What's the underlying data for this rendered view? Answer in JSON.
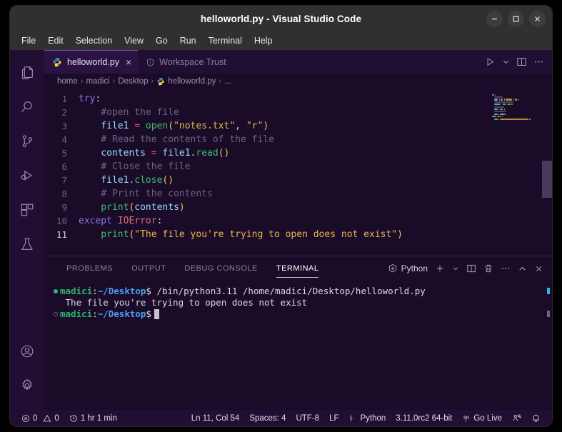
{
  "window": {
    "title": "helloworld.py - Visual Studio Code",
    "controls": [
      {
        "name": "minimize-button",
        "glyph": "minimize"
      },
      {
        "name": "maximize-button",
        "glyph": "maximize"
      },
      {
        "name": "close-button",
        "glyph": "close"
      }
    ]
  },
  "menubar": {
    "items": [
      "File",
      "Edit",
      "Selection",
      "View",
      "Go",
      "Run",
      "Terminal",
      "Help"
    ]
  },
  "activitybar": {
    "top_items": [
      {
        "name": "explorer",
        "label": "Explorer"
      },
      {
        "name": "search",
        "label": "Search"
      },
      {
        "name": "source-control",
        "label": "Source Control"
      },
      {
        "name": "run-and-debug",
        "label": "Run and Debug"
      },
      {
        "name": "extensions",
        "label": "Extensions"
      },
      {
        "name": "testing",
        "label": "Testing"
      }
    ],
    "bottom_items": [
      {
        "name": "accounts",
        "label": "Accounts"
      },
      {
        "name": "manage",
        "label": "Manage"
      }
    ]
  },
  "tabs": {
    "active": {
      "label": "helloworld.py",
      "close": "×"
    },
    "inactive": {
      "label": "Workspace Trust"
    },
    "actions": [
      "run-python-file",
      "run-chevron",
      "split-editor",
      "more-actions"
    ]
  },
  "breadcrumbs": {
    "segments": [
      "home",
      "madici",
      "Desktop",
      "helloworld.py",
      "..."
    ],
    "separator": "›"
  },
  "editor": {
    "lines": [
      {
        "num": "1",
        "tokens": [
          {
            "t": "kw",
            "v": "try"
          },
          {
            "t": "punct",
            "v": ":"
          }
        ]
      },
      {
        "num": "2",
        "tokens": [
          {
            "t": "cmt",
            "v": "    #open the file"
          }
        ]
      },
      {
        "num": "3",
        "tokens": [
          {
            "t": "var",
            "v": "    file1 "
          },
          {
            "t": "op",
            "v": "="
          },
          {
            "t": "fn",
            "v": " open"
          },
          {
            "t": "paren",
            "v": "("
          },
          {
            "t": "str",
            "v": "\"notes.txt\""
          },
          {
            "t": "punct",
            "v": ", "
          },
          {
            "t": "str",
            "v": "\"r\""
          },
          {
            "t": "paren",
            "v": ")"
          }
        ]
      },
      {
        "num": "4",
        "tokens": [
          {
            "t": "cmt",
            "v": "    # Read the contents of the file"
          }
        ]
      },
      {
        "num": "5",
        "tokens": [
          {
            "t": "var",
            "v": "    contents "
          },
          {
            "t": "op",
            "v": "="
          },
          {
            "t": "var",
            "v": " file1"
          },
          {
            "t": "dot",
            "v": "."
          },
          {
            "t": "fn",
            "v": "read"
          },
          {
            "t": "paren",
            "v": "()"
          }
        ]
      },
      {
        "num": "6",
        "tokens": [
          {
            "t": "cmt",
            "v": "    # Close the file"
          }
        ]
      },
      {
        "num": "7",
        "tokens": [
          {
            "t": "var",
            "v": "    file1"
          },
          {
            "t": "dot",
            "v": "."
          },
          {
            "t": "fn",
            "v": "close"
          },
          {
            "t": "paren",
            "v": "()"
          }
        ]
      },
      {
        "num": "8",
        "tokens": [
          {
            "t": "cmt",
            "v": "    # Print the contents"
          }
        ]
      },
      {
        "num": "9",
        "tokens": [
          {
            "t": "fn",
            "v": "    print"
          },
          {
            "t": "paren",
            "v": "("
          },
          {
            "t": "var",
            "v": "contents"
          },
          {
            "t": "paren",
            "v": ")"
          }
        ]
      },
      {
        "num": "10",
        "tokens": [
          {
            "t": "kw",
            "v": "except "
          },
          {
            "t": "err",
            "v": "IOError"
          },
          {
            "t": "punct",
            "v": ":"
          }
        ]
      },
      {
        "num": "11",
        "tokens": [
          {
            "t": "fn",
            "v": "    print"
          },
          {
            "t": "paren",
            "v": "("
          },
          {
            "t": "str",
            "v": "\"The file you're trying to open does not exist\""
          },
          {
            "t": "paren",
            "v": ")"
          }
        ],
        "current": true
      }
    ]
  },
  "panel": {
    "tabs": [
      {
        "label": "PROBLEMS",
        "active": false
      },
      {
        "label": "OUTPUT",
        "active": false
      },
      {
        "label": "DEBUG CONSOLE",
        "active": false
      },
      {
        "label": "TERMINAL",
        "active": true
      }
    ],
    "shell_label": "Python",
    "actions": [
      "new-terminal",
      "terminal-dropdown",
      "split-terminal",
      "kill-terminal",
      "more-actions",
      "collapse-panel",
      "close-panel"
    ]
  },
  "terminal": {
    "lines": [
      {
        "marker": "filled",
        "user": "madici",
        "colon": ":",
        "path": "~/Desktop",
        "dollar": "$",
        "command": " /bin/python3.11 /home/madici/Desktop/helloworld.py"
      },
      {
        "marker": "none",
        "output": " The file you're trying to open does not exist"
      },
      {
        "marker": "hollow",
        "user": "madici",
        "colon": ":",
        "path": "~/Desktop",
        "dollar": "$",
        "command": ""
      }
    ]
  },
  "statusbar": {
    "errors": "0",
    "warnings": "0",
    "timer": "1 hr 1 min",
    "cursor_position": "Ln 11, Col 54",
    "indentation": "Spaces: 4",
    "encoding": "UTF-8",
    "eol": "LF",
    "language": "Python",
    "interpreter": "3.11.0rc2 64-bit",
    "go_live": "Go Live"
  },
  "colors": {
    "accent": "#7a4ec9",
    "background": "#1a0c28",
    "activitybar": "#200f33",
    "titlebar": "#303030",
    "keyword": "#8a7ae8",
    "function": "#3fbf6f",
    "string": "#e8b64a",
    "comment": "#6d6382",
    "operator": "#e05561",
    "error": "#e06c75",
    "terminal_user": "#2bb56b",
    "terminal_path": "#4a9ef5"
  }
}
